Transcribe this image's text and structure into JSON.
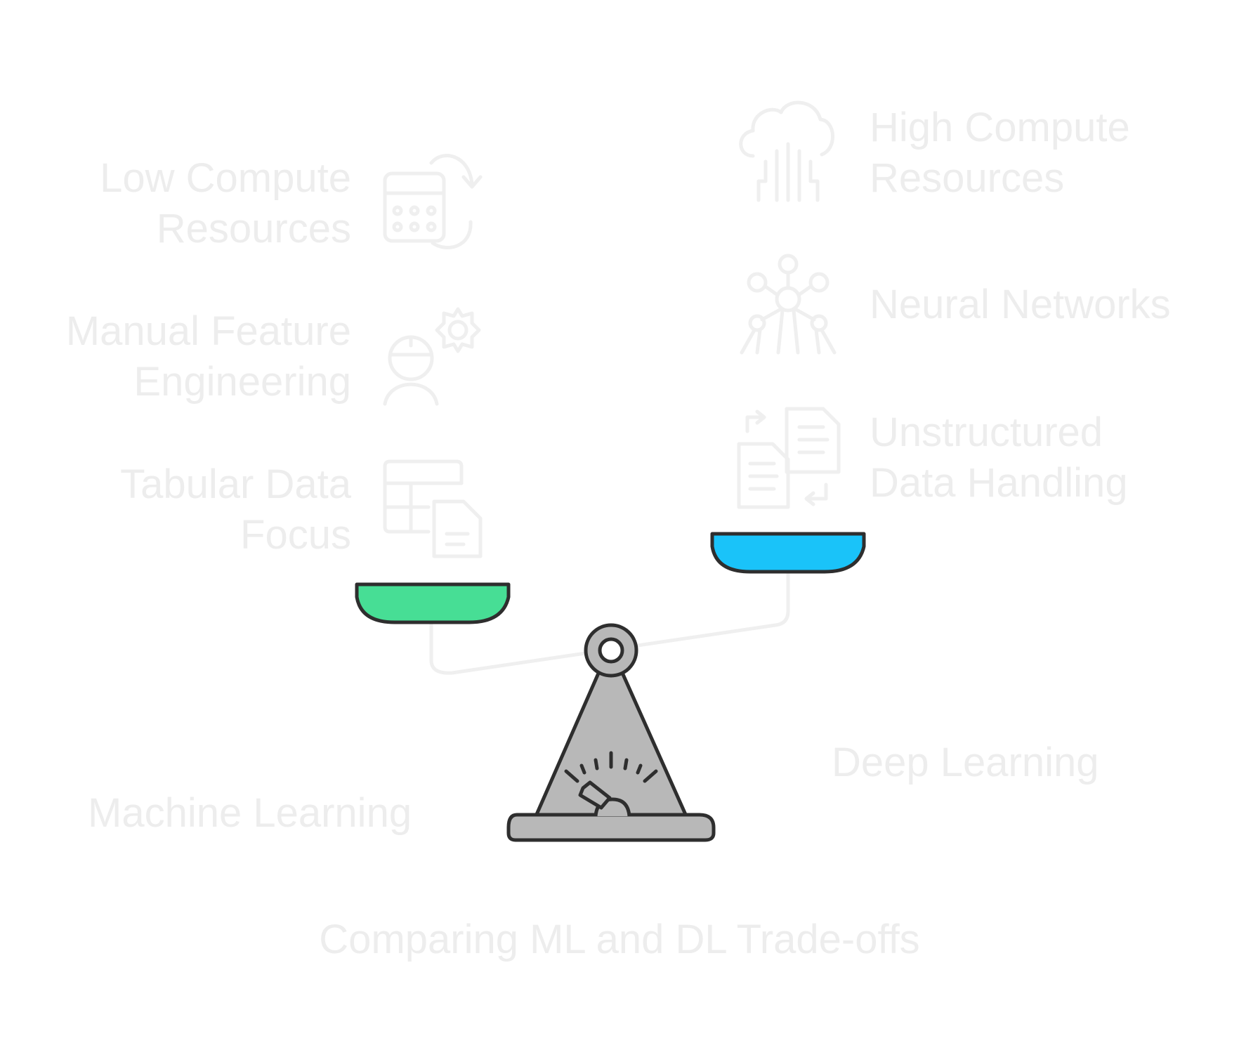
{
  "title": "Comparing ML and DL Trade-offs",
  "left": {
    "name": "Machine Learning",
    "pan_color": "#47de95",
    "items": [
      {
        "lines": [
          "Low Compute",
          "Resources"
        ],
        "icon": "calculator-cycle-icon"
      },
      {
        "lines": [
          "Manual Feature",
          "Engineering"
        ],
        "icon": "engineer-gear-icon"
      },
      {
        "lines": [
          "Tabular Data",
          "Focus"
        ],
        "icon": "table-document-icon"
      }
    ]
  },
  "right": {
    "name": "Deep Learning",
    "pan_color": "#1ac3f9",
    "items": [
      {
        "lines": [
          "High Compute",
          "Resources"
        ],
        "icon": "cloud-circuit-icon"
      },
      {
        "lines": [
          "Neural Networks"
        ],
        "icon": "neural-network-icon"
      },
      {
        "lines": [
          "Unstructured",
          "Data Handling"
        ],
        "icon": "documents-exchange-icon"
      }
    ]
  },
  "scale": {
    "base_color": "#b8b8b8",
    "outline_color": "#2e2e2e",
    "icon": "balance-scale-icon"
  }
}
